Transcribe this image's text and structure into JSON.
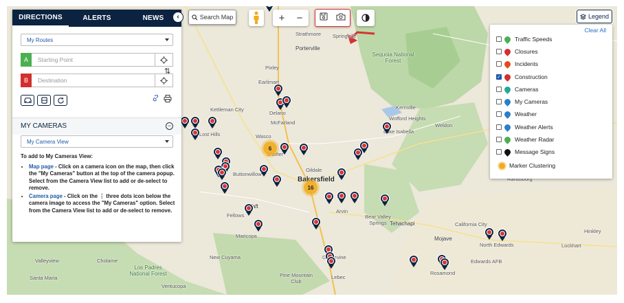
{
  "tabs": [
    "DIRECTIONS",
    "ALERTS",
    "NEWS"
  ],
  "directions": {
    "route_select": "My Routes",
    "start_label": "A",
    "start_placeholder": "Starting Point",
    "dest_label": "B",
    "dest_placeholder": "Destination",
    "start_color": "#4caf50",
    "dest_color": "#d32f2f"
  },
  "my_cameras": {
    "title": "MY CAMERAS",
    "view_select": "My Camera View",
    "help_heading": "To add to My Cameras View:",
    "items": [
      {
        "link": "Map page",
        "text": " - Click on a camera icon on the map, then click the \"My Cameras\" button at the top of the camera popup. Select from the Camera View list to add or de-select to remove."
      },
      {
        "link": "Camera page",
        "text": " - Click on the  ⋮ three dots icon below the camera image to access the \"My Cameras\" option. Select from the Camera View list to add or de-select to remove."
      }
    ]
  },
  "toolbar": {
    "search_map": "Search Map",
    "zoom_in": "+",
    "zoom_out": "−",
    "legend": "Legend"
  },
  "legend": {
    "clear_all": "Clear All",
    "items": [
      {
        "label": "Traffic Speeds",
        "checked": false,
        "icon": "traffic-speeds-icon",
        "color": "#4caf50"
      },
      {
        "label": "Closures",
        "checked": false,
        "icon": "closures-icon",
        "color": "#d32f2f"
      },
      {
        "label": "Incidents",
        "checked": false,
        "icon": "incidents-icon",
        "color": "#e64a19"
      },
      {
        "label": "Construction",
        "checked": true,
        "icon": "construction-icon",
        "color": "#d32f2f"
      },
      {
        "label": "Cameras",
        "checked": false,
        "icon": "cameras-icon",
        "color": "#26a69a"
      },
      {
        "label": "My Cameras",
        "checked": false,
        "icon": "my-cameras-icon",
        "color": "#2a7fc9"
      },
      {
        "label": "Weather",
        "checked": false,
        "icon": "weather-icon",
        "color": "#2a7fc9"
      },
      {
        "label": "Weather Alerts",
        "checked": false,
        "icon": "weather-alerts-icon",
        "color": "#2a7fc9"
      },
      {
        "label": "Weather Radar",
        "checked": false,
        "icon": "weather-radar-icon",
        "color": "#4caf50"
      },
      {
        "label": "Message Signs",
        "checked": false,
        "icon": "message-signs-icon",
        "color": "#111111"
      },
      {
        "label": "Marker Clustering",
        "checked": null,
        "icon": "marker-clustering-icon",
        "color": "#f2ac1e"
      }
    ]
  },
  "map": {
    "labels": [
      "Strathmore",
      "Springville",
      "Porterville",
      "Pixley",
      "Earlimart",
      "Delano",
      "McFarland",
      "Lost Hills",
      "Wasco",
      "Shafter",
      "Oildale",
      "Bakersfield",
      "Buttonwillow",
      "Kernville",
      "Wofford Heights",
      "Lake Isabella",
      "Weldon",
      "Arvin",
      "Bear Valley Springs",
      "Tehachapi",
      "Taft",
      "Maricopa",
      "Fellows",
      "Mojave",
      "California City",
      "North Edwards",
      "Lockhart",
      "Edwards AFB",
      "Hinkley",
      "Randsburg",
      "Grapevine",
      "Lebec",
      "Rosamond",
      "New Cuyama",
      "Pine Mountain Club",
      "Santa Maria",
      "Kettleman City",
      "Sequoia National Forest",
      "Ventucopa",
      "Los Padres National Forest",
      "Cholame",
      "Valleyview"
    ],
    "clusters": [
      "6",
      "16"
    ]
  },
  "colors": {
    "navy": "#0b2340",
    "link": "#1e5aa8",
    "highlight": "#d33333"
  }
}
